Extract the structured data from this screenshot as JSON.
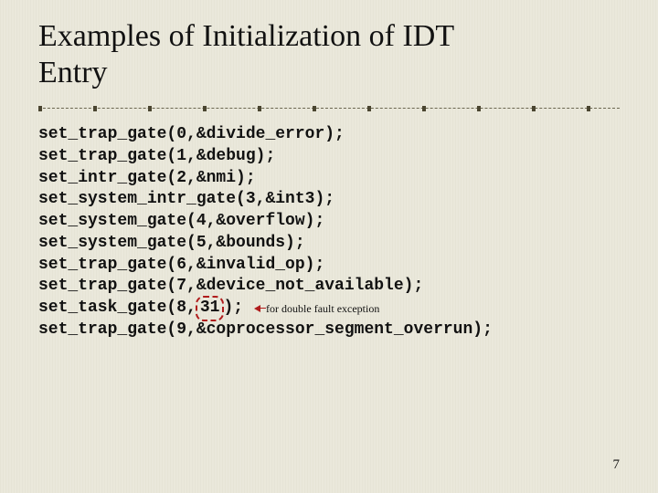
{
  "title_line1": "Examples of Initialization of IDT",
  "title_line2": "Entry",
  "code_lines": {
    "l0": "set_trap_gate(0,&divide_error);",
    "l1": "set_trap_gate(1,&debug);",
    "l2": "set_intr_gate(2,&nmi);",
    "l3": "set_system_intr_gate(3,&int3);",
    "l4": "set_system_gate(4,&overflow);",
    "l5": "set_system_gate(5,&bounds);",
    "l6": "set_trap_gate(6,&invalid_op);",
    "l7": "set_trap_gate(7,&device_not_available);",
    "l8a": "set_task_gate(8,",
    "l8b": "31",
    "l8c": ");",
    "l9": "set_trap_gate(9,&coprocessor_segment_overrun);"
  },
  "annotation": "for double fault exception",
  "page_number": "7"
}
